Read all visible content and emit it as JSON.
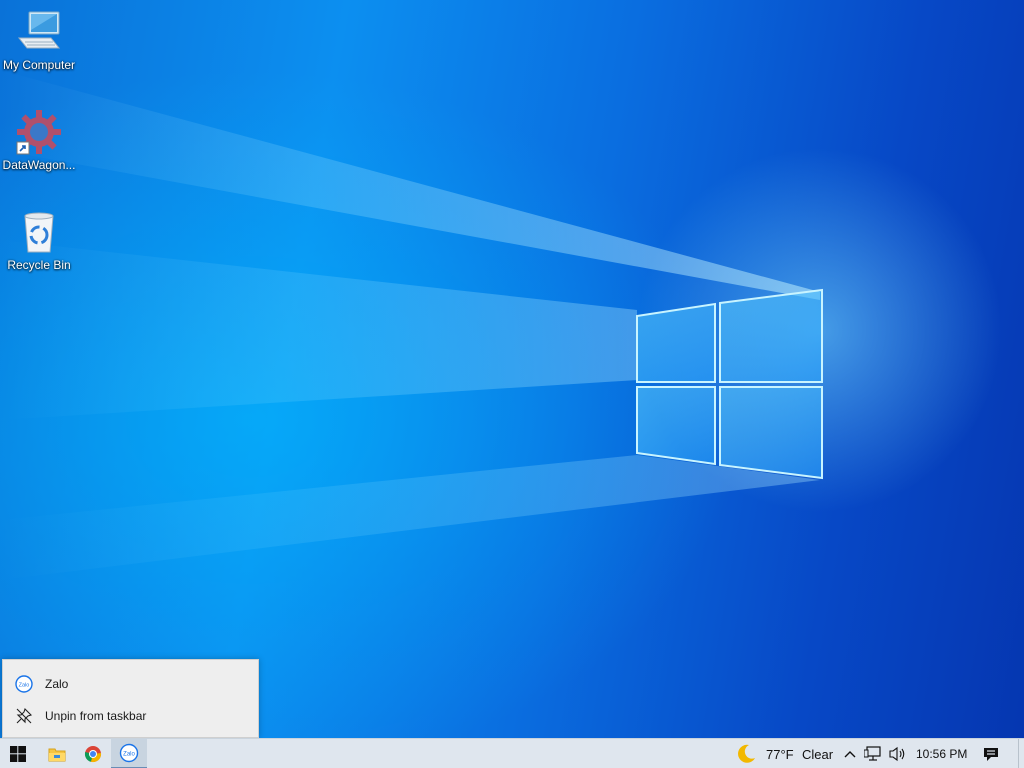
{
  "desktop": {
    "icons": [
      {
        "label": "My Computer",
        "icon": "computer-icon"
      },
      {
        "label": "DataWagon...",
        "icon": "datawagon-gear-icon"
      },
      {
        "label": "Recycle Bin",
        "icon": "recycle-bin-icon"
      }
    ]
  },
  "jumplist": {
    "app_name": "Zalo",
    "app_icon_text": "Zalo",
    "unpin_label": "Unpin from taskbar"
  },
  "taskbar": {
    "zalo_icon_text": "Zalo",
    "weather": {
      "temperature": "77°F",
      "condition": "Clear",
      "icon": "moon-icon"
    },
    "clock": "10:56 PM"
  },
  "colors": {
    "taskbar_bg": "#dfe6ee",
    "jumplist_bg": "#eeeeee",
    "zalo_blue": "#1a74e8"
  }
}
